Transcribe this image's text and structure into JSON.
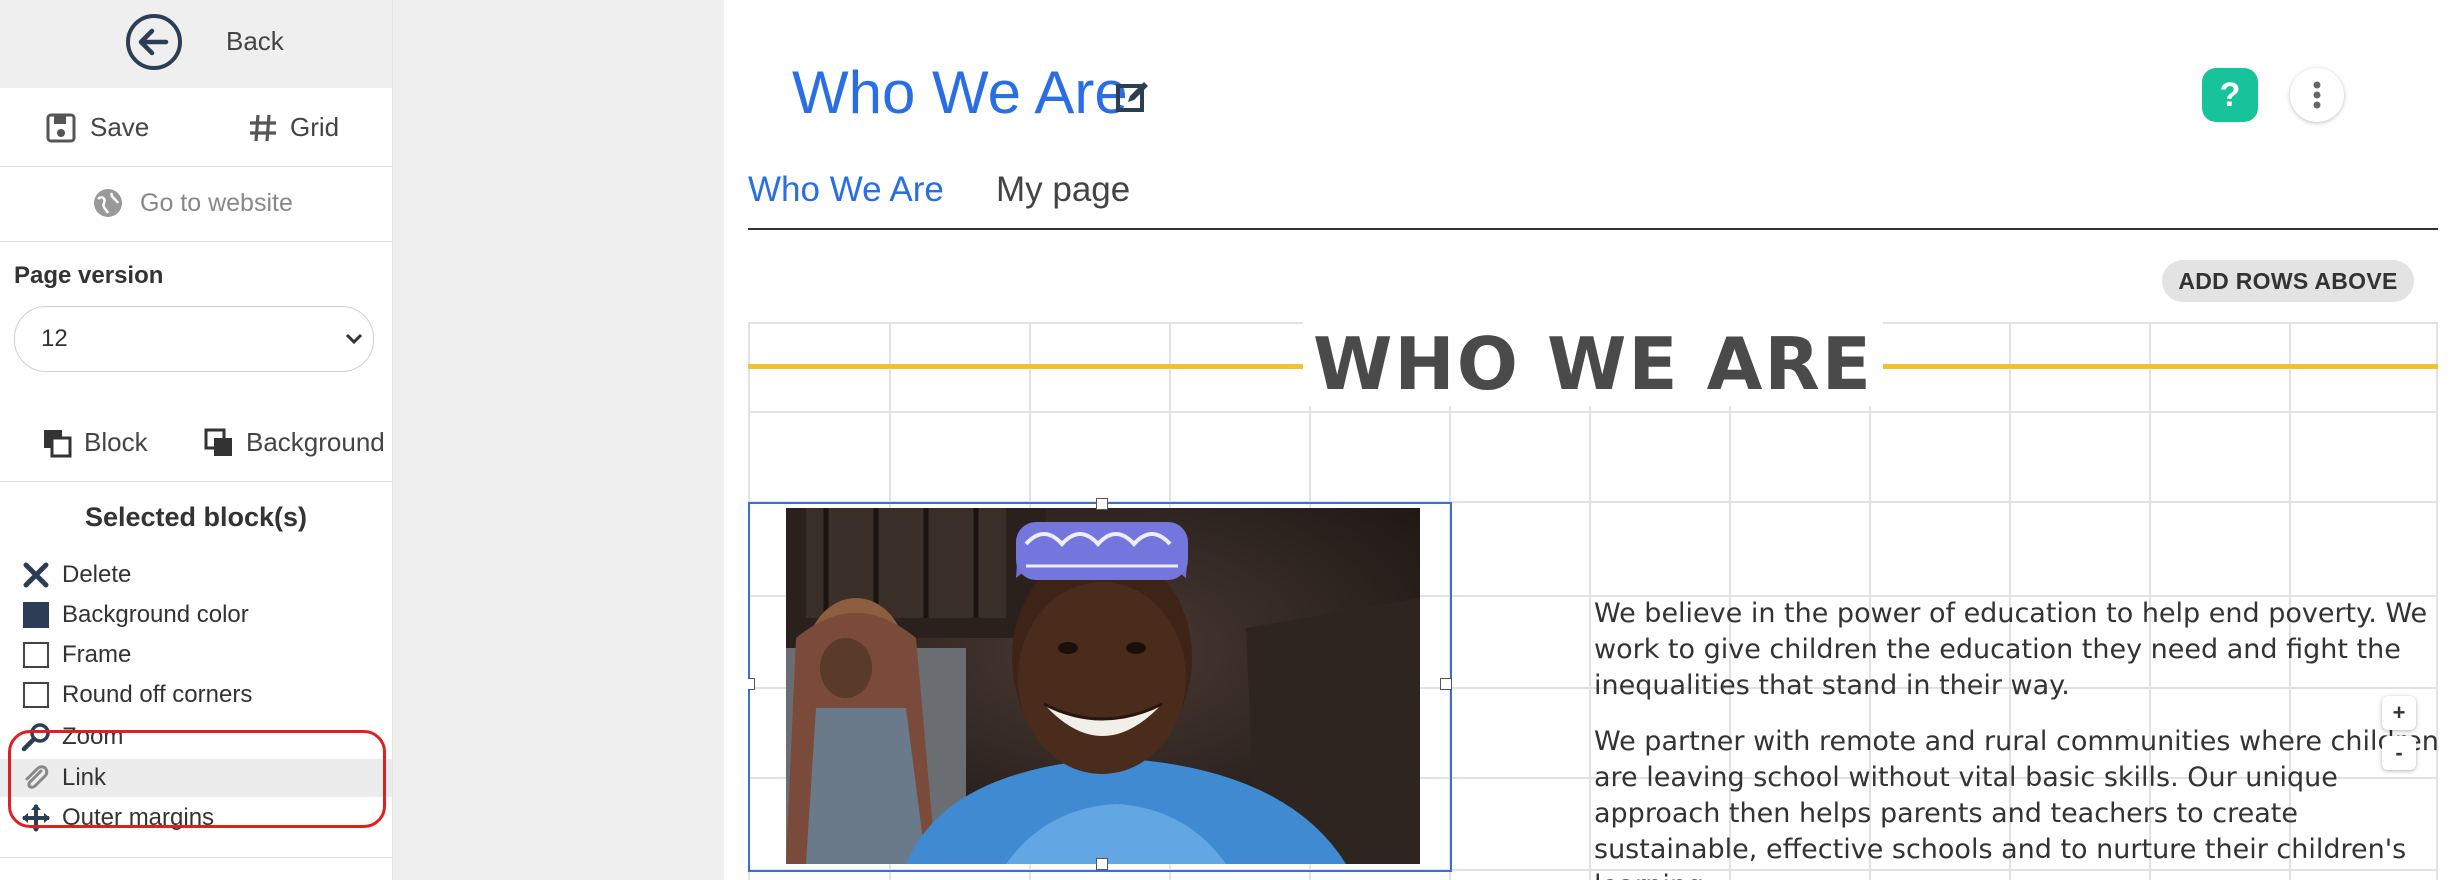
{
  "sidebar": {
    "back_label": "Back",
    "save_label": "Save",
    "grid_label": "Grid",
    "go_to_website_label": "Go to website",
    "page_version_label": "Page version",
    "page_version_value": "12",
    "block_label": "Block",
    "background_label": "Background",
    "selected_blocks_title": "Selected block(s)",
    "menu_items": [
      {
        "label": "Delete",
        "icon": "close-icon"
      },
      {
        "label": "Background color",
        "icon": "color-swatch-icon"
      },
      {
        "label": "Frame",
        "icon": "checkbox-icon"
      },
      {
        "label": "Round off corners",
        "icon": "checkbox-icon"
      },
      {
        "label": "Zoom",
        "icon": "magnifier-icon"
      },
      {
        "label": "Link",
        "icon": "paperclip-icon"
      },
      {
        "label": "Outer margins",
        "icon": "move-arrows-icon"
      }
    ],
    "highlight_color": "#e02020"
  },
  "header": {
    "page_title": "Who We Are",
    "help_label": "?",
    "accent_color": "#2a6ee6",
    "help_color": "#17c39b"
  },
  "tabs": [
    {
      "label": "Who We Are",
      "active": true
    },
    {
      "label": "My page",
      "active": false
    }
  ],
  "toolbar": {
    "add_rows_label": "ADD ROWS ABOVE"
  },
  "content": {
    "heading": "WHO WE ARE",
    "heading_line_color": "#f2c12e",
    "paragraphs": [
      "We believe in the power of education to help end poverty. We work to give children the education they need and fight the inequalities that stand in their way.",
      "We partner with remote and rural communities where children are leaving school without vital basic skills. Our unique approach then helps parents and teachers to create sustainable, effective schools and to nurture their children's learning."
    ],
    "plus_label": "+",
    "minus_label": "-"
  }
}
